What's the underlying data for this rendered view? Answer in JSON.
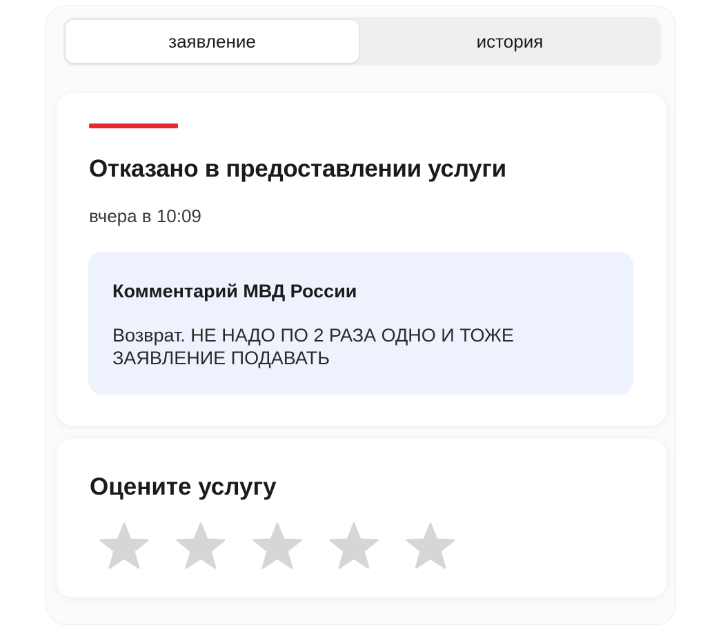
{
  "tabs": [
    {
      "label": "заявление",
      "active": true
    },
    {
      "label": "история",
      "active": false
    }
  ],
  "status": {
    "title": "Отказано в предоставлении услуги",
    "time": "вчера в 10:09",
    "accent_color": "#e52b2b"
  },
  "comment": {
    "title": "Комментарий МВД России",
    "text": "Возврат. НЕ НАДО ПО 2 РАЗА ОДНО И ТОЖЕ ЗАЯВЛЕНИЕ ПОДАВАТЬ",
    "background_color": "#eef2fc"
  },
  "rating": {
    "title": "Оцените услугу",
    "max_stars": 5,
    "selected": 0,
    "star_icon": "star-icon",
    "star_color": "#d6d6d6"
  }
}
